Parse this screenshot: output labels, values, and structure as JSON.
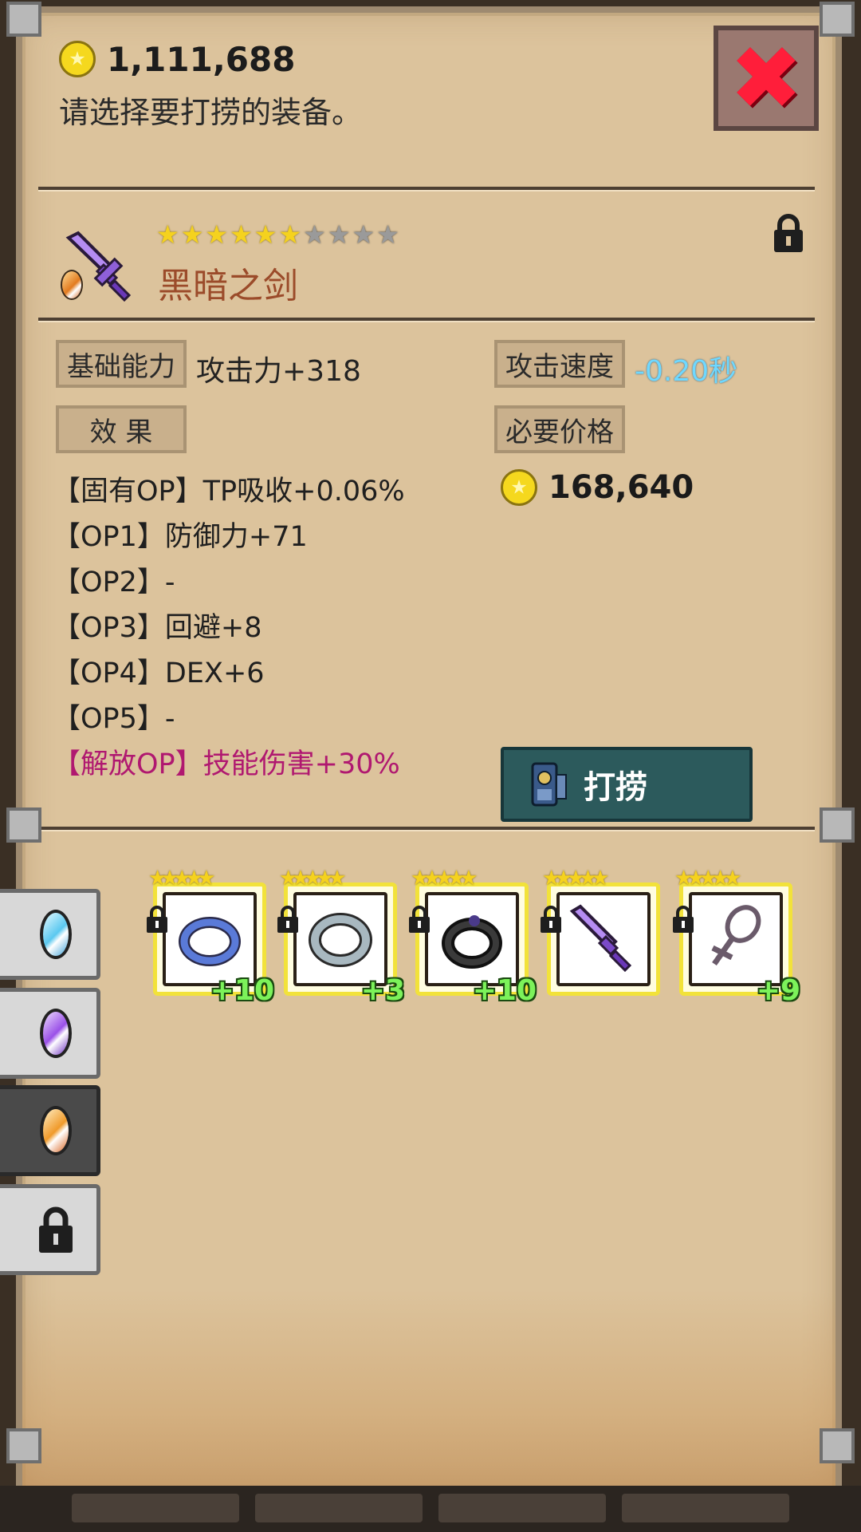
{
  "header": {
    "coins": "1,111,688",
    "prompt": "请选择要打捞的装备。"
  },
  "close_glyph": "✖",
  "item": {
    "name": "黑暗之剑",
    "stars_filled": 6,
    "stars_total": 10,
    "icon": "purple-sword-icon"
  },
  "stats": {
    "base_label": "基础能力",
    "base_value": "攻击力+318",
    "speed_label": "攻击速度",
    "speed_value": "-0.20秒",
    "effect_label": "效 果",
    "price_label": "必要价格",
    "price_value": "168,640"
  },
  "options": [
    "【固有OP】TP吸收+0.06%",
    "【OP1】防御力+71",
    "【OP2】-",
    "【OP3】回避+8",
    "【OP4】DEX+6",
    "【OP5】-",
    "【解放OP】技能伤害+30%"
  ],
  "salvage_button": "打捞",
  "tabs": [
    {
      "icon": "blue-gem-icon",
      "active": false
    },
    {
      "icon": "purple-gem-icon",
      "active": false
    },
    {
      "icon": "orange-gem-icon",
      "active": true
    },
    {
      "icon": "lock-icon",
      "active": false
    }
  ],
  "inventory": [
    {
      "icon": "blue-ring-icon",
      "level": "+10"
    },
    {
      "icon": "silver-ring-icon",
      "level": "+3"
    },
    {
      "icon": "black-ring-icon",
      "level": "+10"
    },
    {
      "icon": "purple-sword-icon",
      "level": ""
    },
    {
      "icon": "ankh-necklace-icon",
      "level": "+9"
    }
  ],
  "colors": {
    "panel_bg": "#dcc39c",
    "close_red": "#ff1e3a",
    "speed_cyan": "#6fd8ff",
    "unleash_pink": "#b01870",
    "plus_green": "#7cf25a",
    "button_teal": "#2c5a5c"
  }
}
